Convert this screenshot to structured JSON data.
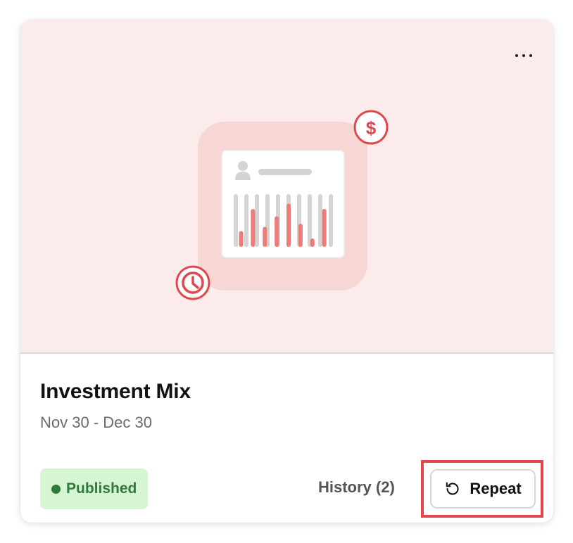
{
  "card": {
    "title": "Investment Mix",
    "date_range": "Nov 30 - Dec 30",
    "status": "Published",
    "history_label": "History (2)",
    "repeat_label": "Repeat"
  },
  "icons": {
    "menu": "more-horizontal-icon",
    "repeat": "rotate-ccw-icon",
    "dollar": "dollar-badge-icon",
    "clock": "clock-badge-icon",
    "user": "user-icon"
  },
  "illustration": {
    "bar_levels": [
      0.3,
      0.72,
      0.38,
      0.58,
      0.82,
      0.44,
      0.16,
      0.72
    ],
    "symbol_dollar": "$"
  },
  "colors": {
    "hero_background": "#fbebea",
    "accent_red": "#e2474d",
    "status_green": "#2f7a3c",
    "status_background": "#d6f5d2",
    "highlight_border": "#e2474d"
  }
}
